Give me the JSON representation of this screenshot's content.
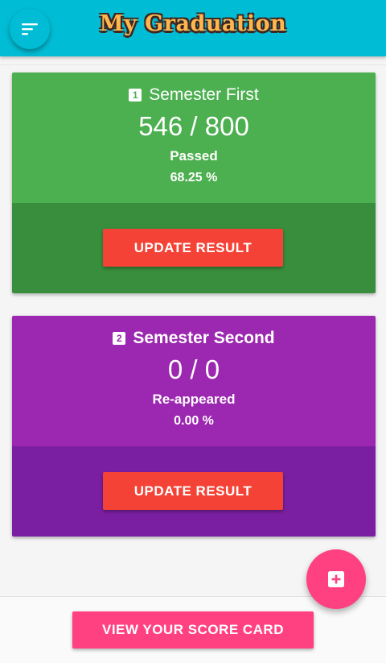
{
  "header": {
    "title": "My Graduation",
    "bg_color": "#00bcd4",
    "menu_icon": "sort-menu-icon"
  },
  "semesters": [
    {
      "badge": "1",
      "title": "Semester First",
      "score": "546 / 800",
      "status": "Passed",
      "percent": "68.25 %",
      "button_label": "UPDATE RESULT",
      "top_color": "#4caf50",
      "bottom_color": "#388e3c"
    },
    {
      "badge": "2",
      "title": "Semester Second",
      "score": "0 / 0",
      "status": "Re-appeared",
      "percent": "0.00 %",
      "button_label": "UPDATE RESULT",
      "top_color": "#9c27b0",
      "bottom_color": "#7b1fa2"
    }
  ],
  "fab": {
    "icon": "add-box-icon",
    "color": "#ff4081"
  },
  "footer": {
    "score_card_label": "VIEW YOUR SCORE CARD"
  },
  "colors": {
    "accent": "#ff4081",
    "button_red": "#f44336"
  }
}
